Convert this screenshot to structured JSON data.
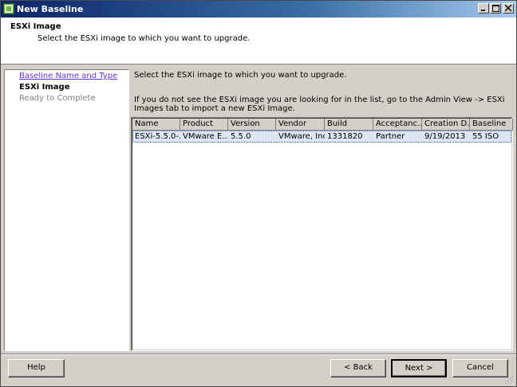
{
  "window": {
    "title": "New Baseline"
  },
  "banner": {
    "title": "ESXi Image",
    "subtitle": "Select the ESXi image to which you want to upgrade."
  },
  "steps": {
    "items": [
      {
        "label": "Baseline Name and Type",
        "state": "link"
      },
      {
        "label": "ESXi Image",
        "state": "current"
      },
      {
        "label": "Ready to Complete",
        "state": "disabled"
      }
    ]
  },
  "main": {
    "instruction": "Select the ESXi image to which you want to upgrade.",
    "help_text": "If you do not see the ESXi image you are looking for in the list, go to the Admin View -> ESXi Images tab to import a new ESXi Image."
  },
  "table": {
    "columns": [
      "Name",
      "Product",
      "Version",
      "Vendor",
      "Build",
      "Acceptanc...",
      "Creation D...",
      "Baseline"
    ],
    "rows": [
      [
        "ESXi-5.5.0-...",
        "VMware E...",
        "5.5.0",
        "VMware, Inc.",
        "1331820",
        "Partner",
        "9/19/2013",
        "55 ISO"
      ]
    ]
  },
  "buttons": {
    "help": "Help",
    "back": "< Back",
    "next": "Next >",
    "cancel": "Cancel"
  },
  "colors": {
    "titlebar_start": "#0a246a",
    "selection": "#dce6f4",
    "link": "#6633cc"
  }
}
